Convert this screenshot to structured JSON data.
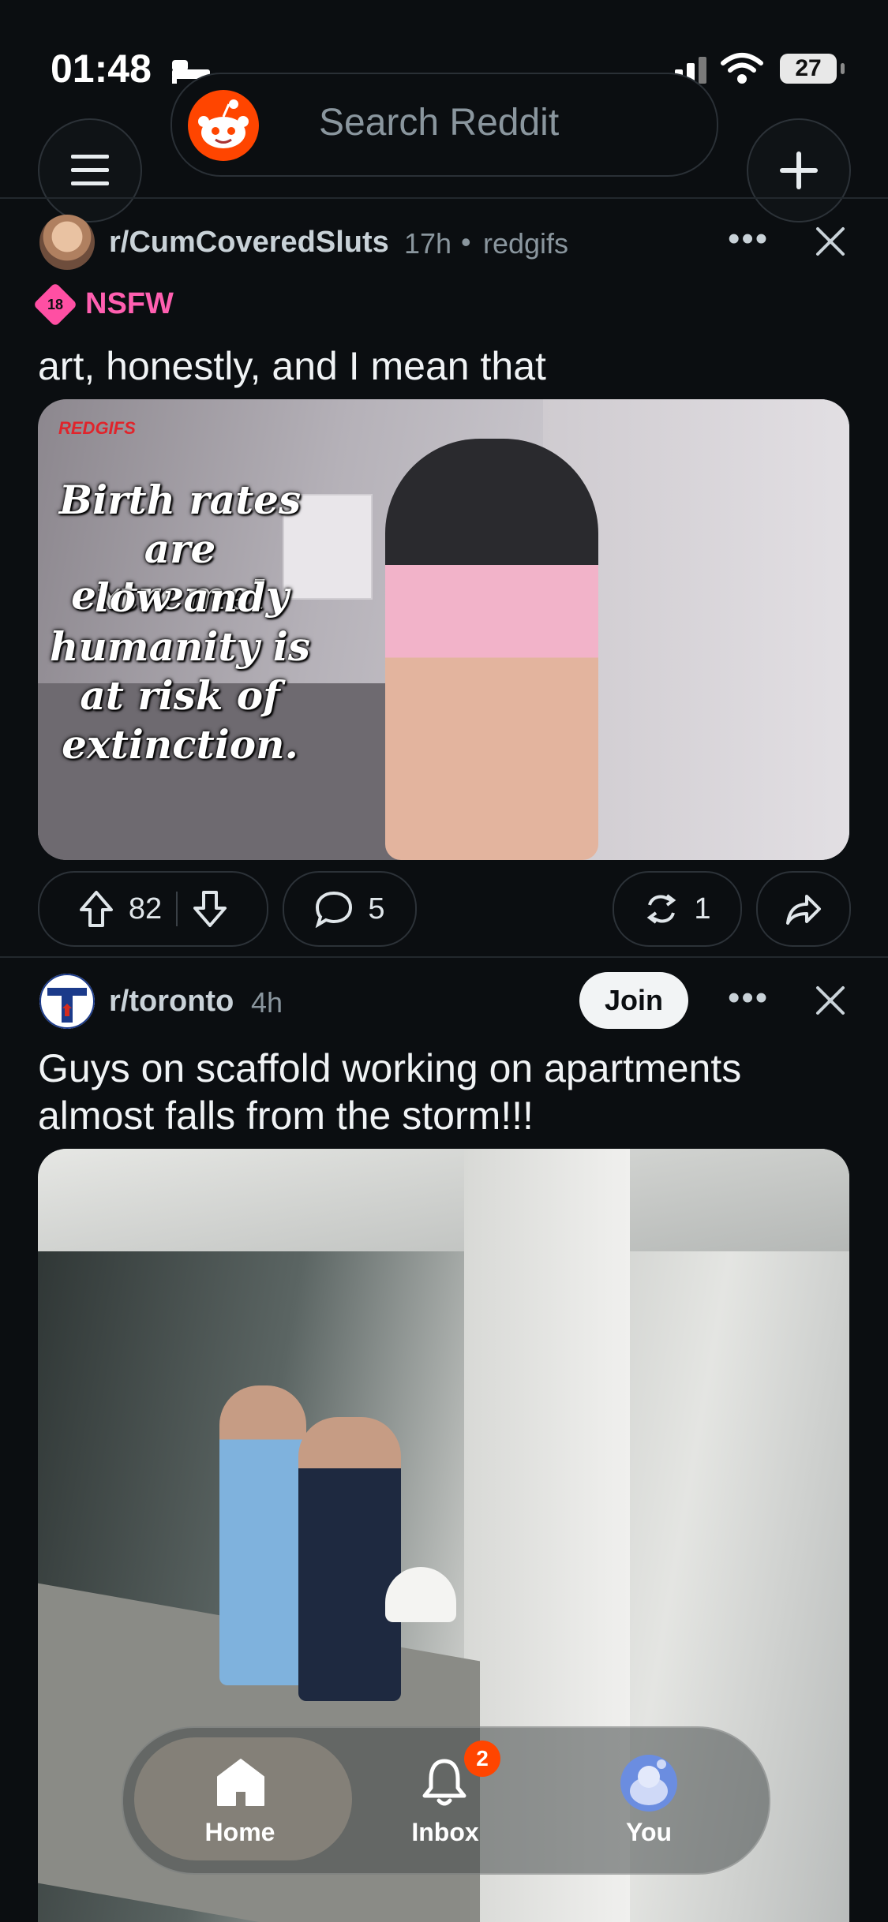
{
  "status_bar": {
    "time": "01:48",
    "battery": "27"
  },
  "header": {
    "search_placeholder": "Search Reddit"
  },
  "posts": [
    {
      "subreddit": "r/CumCoveredSluts",
      "age": "17h",
      "source": "redgifs",
      "tag": "NSFW",
      "tag_badge": "18",
      "title": "art, honestly, and I mean that",
      "media_watermark": "REDGIFS",
      "media_caption": [
        "Birth rates",
        "are extremely",
        "low and",
        "humanity is",
        "at risk of",
        "extinction."
      ],
      "upvotes": "82",
      "comments": "5",
      "crossposts": "1"
    },
    {
      "subreddit": "r/toronto",
      "age": "4h",
      "join_label": "Join",
      "title_line1": "Guys on scaffold working on apartments",
      "title_line2": "almost falls from the storm!!!"
    }
  ],
  "bottom_nav": {
    "items": [
      {
        "label": "Home"
      },
      {
        "label": "Inbox"
      },
      {
        "label": "You"
      }
    ],
    "inbox_badge": "2"
  },
  "colors": {
    "background": "#0b0e11",
    "accent": "#ff4500",
    "nsfw": "#ff5fb0"
  }
}
